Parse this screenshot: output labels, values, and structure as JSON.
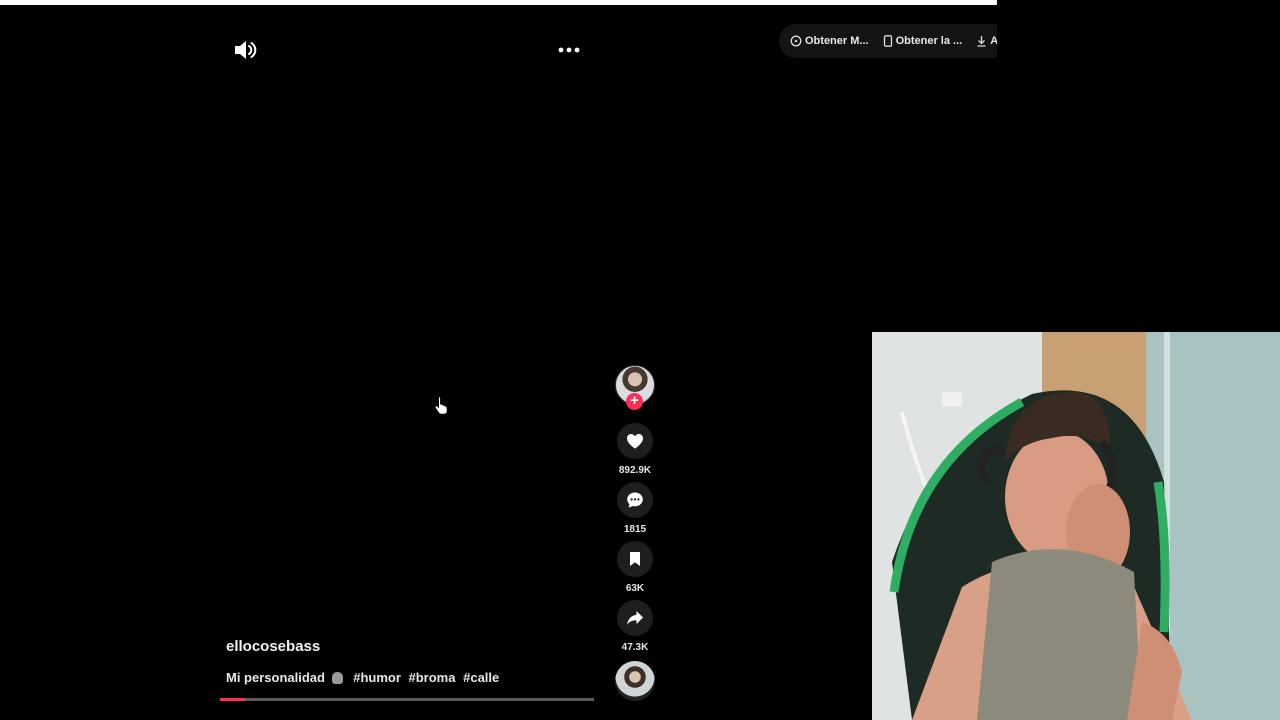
{
  "player": {
    "progress_fraction": 0.07
  },
  "top_actions": [
    {
      "label": "Obtener M...",
      "icon": "compass-icon"
    },
    {
      "label": "Obtener la ...",
      "icon": "phone-icon"
    },
    {
      "label": "Ap",
      "icon": "download-icon"
    }
  ],
  "rail": {
    "likes": "892.9K",
    "comments": "1815",
    "saves": "63K",
    "shares": "47.3K"
  },
  "video": {
    "author": "ellocosebass",
    "caption_text": "Mi personalidad",
    "hashtags": [
      "#humor",
      "#broma",
      "#calle"
    ]
  },
  "colors": {
    "accent": "#fe2c55",
    "background": "#000000"
  }
}
